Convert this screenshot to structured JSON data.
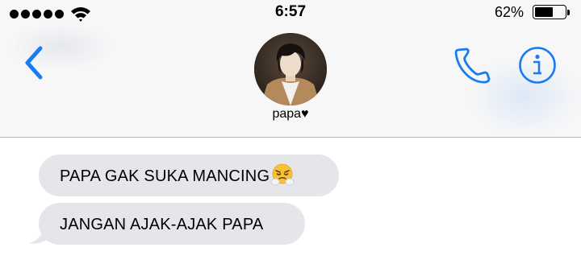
{
  "status_bar": {
    "time": "6:57",
    "battery_percent": "62%",
    "battery_level": 0.62,
    "signal_bars": 5,
    "icons": [
      "signal-dots-icon",
      "wifi-icon",
      "battery-icon"
    ]
  },
  "nav": {
    "back_icon": "chevron-left-icon",
    "contact_name": "papa♥",
    "phone_icon": "phone-icon",
    "info_icon": "info-icon"
  },
  "messages": [
    {
      "text": "PAPA GAK SUKA MANCING",
      "emoji": "face-with-steam-from-nose",
      "direction": "received"
    },
    {
      "text": "JANGAN AJAK-AJAK PAPA",
      "direction": "received"
    }
  ],
  "colors": {
    "accent": "#1a7cf0",
    "bubble_received": "#e5e5ea",
    "header_bg": "#f7f7f8"
  }
}
